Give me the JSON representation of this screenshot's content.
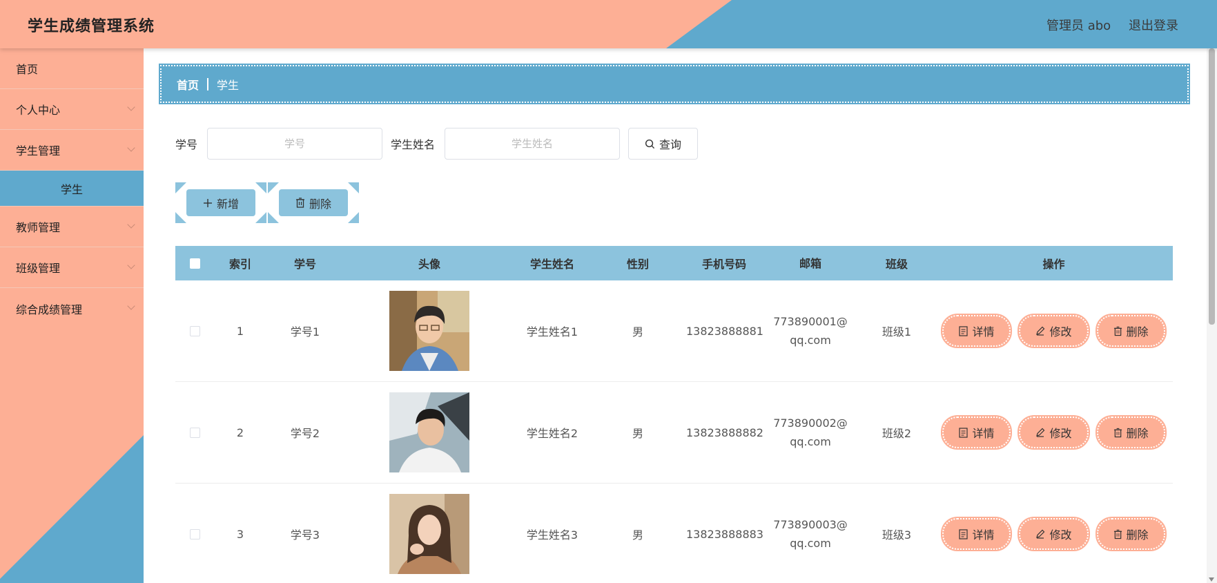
{
  "header": {
    "title": "学生成绩管理系统",
    "user": "管理员 abo",
    "logout": "退出登录"
  },
  "sidebar": {
    "items": [
      {
        "label": "首页",
        "has_arrow": false
      },
      {
        "label": "个人中心",
        "has_arrow": true
      },
      {
        "label": "学生管理",
        "has_arrow": true
      },
      {
        "label": "教师管理",
        "has_arrow": true
      },
      {
        "label": "班级管理",
        "has_arrow": true
      },
      {
        "label": "综合成绩管理",
        "has_arrow": true
      }
    ],
    "active_sub": "学生"
  },
  "breadcrumb": {
    "home": "首页",
    "current": "学生"
  },
  "search": {
    "student_no_label": "学号",
    "student_no_placeholder": "学号",
    "student_name_label": "学生姓名",
    "student_name_placeholder": "学生姓名",
    "query_button": "查询"
  },
  "actions": {
    "add": "新增",
    "delete": "删除"
  },
  "table": {
    "headers": [
      "索引",
      "学号",
      "头像",
      "学生姓名",
      "性别",
      "手机号码",
      "邮箱",
      "班级",
      "操作"
    ],
    "rows": [
      {
        "index": "1",
        "student_no": "学号1",
        "name": "学生姓名1",
        "gender": "男",
        "phone": "13823888881",
        "email_a": "773890001@",
        "email_b": "qq.com",
        "class": "班级1"
      },
      {
        "index": "2",
        "student_no": "学号2",
        "name": "学生姓名2",
        "gender": "男",
        "phone": "13823888882",
        "email_a": "773890002@",
        "email_b": "qq.com",
        "class": "班级2"
      },
      {
        "index": "3",
        "student_no": "学号3",
        "name": "学生姓名3",
        "gender": "男",
        "phone": "13823888883",
        "email_a": "773890003@",
        "email_b": "qq.com",
        "class": "班级3"
      }
    ],
    "ops": {
      "detail": "详情",
      "edit": "修改",
      "delete": "删除"
    }
  },
  "colors": {
    "salmon": "#fdaf95",
    "blue": "#5fa9cd",
    "light_blue": "#8cc3dd"
  }
}
